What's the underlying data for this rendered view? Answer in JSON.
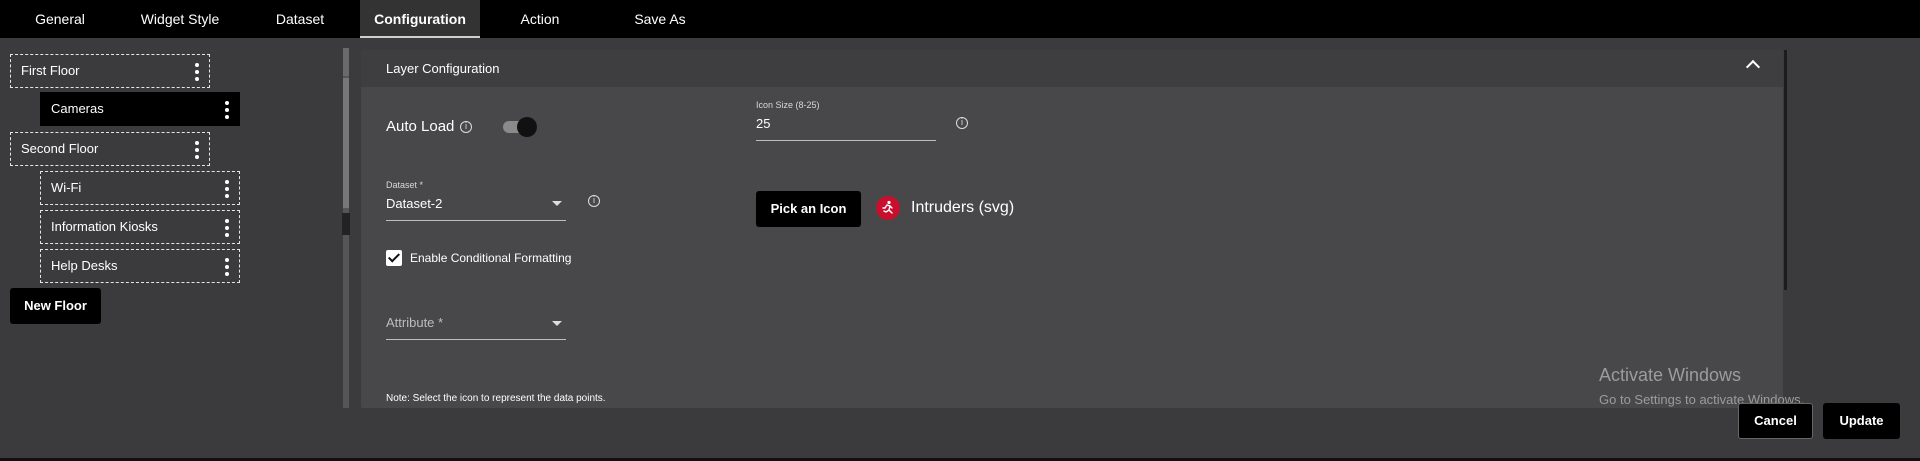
{
  "tabs": [
    {
      "label": "General"
    },
    {
      "label": "Widget Style"
    },
    {
      "label": "Dataset"
    },
    {
      "label": "Configuration",
      "active": true
    },
    {
      "label": "Action"
    },
    {
      "label": "Save As"
    }
  ],
  "tree": {
    "floors": [
      {
        "label": "First Floor"
      },
      {
        "label": "Cameras",
        "selected": true
      },
      {
        "label": "Second Floor"
      },
      {
        "label": "Wi-Fi"
      },
      {
        "label": "Information Kiosks"
      },
      {
        "label": "Help Desks"
      }
    ],
    "new_floor_label": "New Floor"
  },
  "panel": {
    "title": "Layer Configuration",
    "auto_load_label": "Auto Load",
    "auto_load_on": true,
    "icon_size": {
      "label": "Icon Size (8-25)",
      "value": "25"
    },
    "dataset": {
      "label": "Dataset *",
      "value": "Dataset-2"
    },
    "pick_icon_label": "Pick an Icon",
    "icon_name": "Intruders (svg)",
    "enable_conditional_label": "Enable Conditional Formatting",
    "enable_conditional_checked": true,
    "attribute": {
      "label": "Attribute *"
    },
    "note": "Note: Select the icon to represent the data points."
  },
  "watermark": {
    "title": "Activate Windows",
    "subtitle": "Go to Settings to activate Windows."
  },
  "footer": {
    "cancel_label": "Cancel",
    "update_label": "Update"
  },
  "colors": {
    "background": "#3b3b3d",
    "panel": "#48474a",
    "panel_header": "#3e3d40",
    "accent_icon": "#c8102e"
  }
}
